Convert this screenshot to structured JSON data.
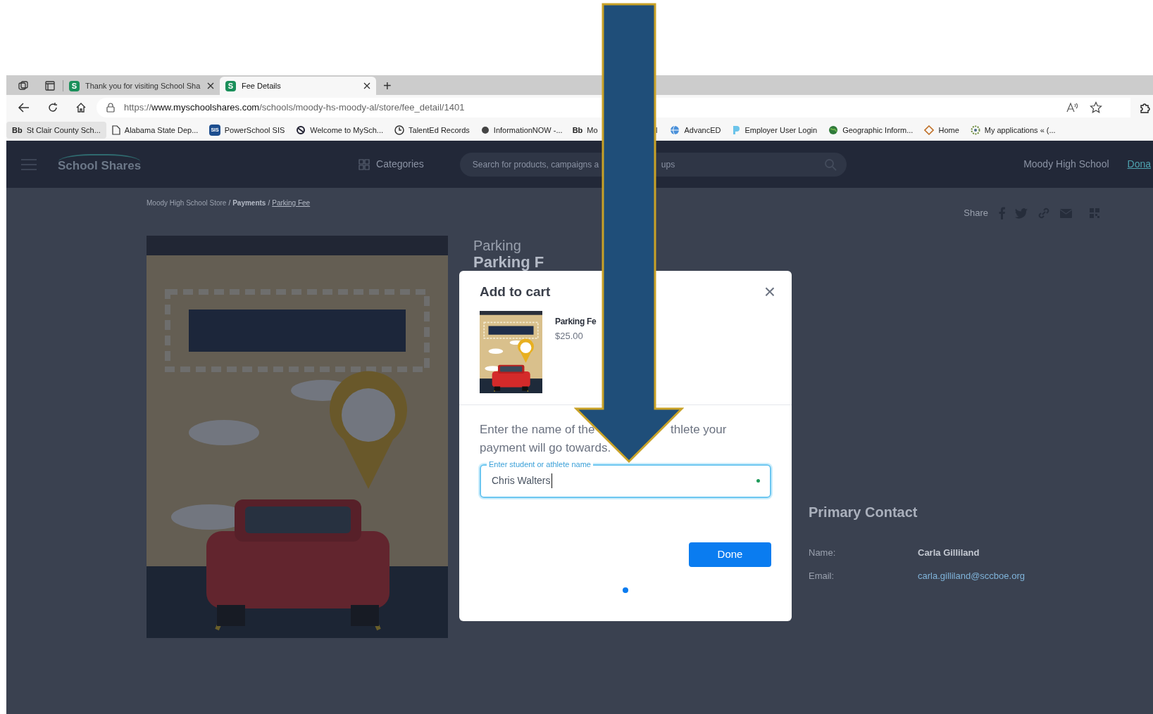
{
  "browser": {
    "tabs": [
      {
        "title": "Thank you for visiting School Sha",
        "favicon": "S",
        "selected": false
      },
      {
        "title": "Fee Details",
        "favicon": "S",
        "selected": true
      }
    ],
    "new_tab": "+",
    "url": {
      "scheme": "https://",
      "host": "www.myschoolshares.com",
      "path": "/schools/moody-hs-moody-al/store/fee_detail/1401"
    },
    "bookmarks": [
      {
        "kind": "bb",
        "icon_text": "Bb",
        "label": "St  Clair County Sch..."
      },
      {
        "kind": "page",
        "label": "Alabama State Dep..."
      },
      {
        "kind": "sis",
        "icon_text": "SIS",
        "label": "PowerSchool SIS"
      },
      {
        "kind": "logo",
        "label": "Welcome to MySch..."
      },
      {
        "kind": "clock",
        "label": "TalentEd Records"
      },
      {
        "kind": "dot",
        "label": "InformationNOW -..."
      },
      {
        "kind": "bb",
        "icon_text": "Bb",
        "label": "Mo"
      },
      {
        "kind": "fragment",
        "label": "l"
      },
      {
        "kind": "globe",
        "label": "AdvancED"
      },
      {
        "kind": "p",
        "label": "Employer User Login"
      },
      {
        "kind": "earth",
        "label": "Geographic Inform..."
      },
      {
        "kind": "diamond",
        "label": "Home"
      },
      {
        "kind": "gear",
        "label": "My applications « (..."
      }
    ]
  },
  "header": {
    "logo": "School Shares",
    "categories": "Categories",
    "search_placeholder": [
      "Search for products, campaigns a",
      "ups"
    ],
    "school": "Moody High School",
    "donate": "Dona"
  },
  "breadcrumb": [
    {
      "kind": "plain",
      "label": "Moody High School Store"
    },
    {
      "kind": "sep",
      "label": "/"
    },
    {
      "kind": "bold",
      "label": "Payments"
    },
    {
      "kind": "sep",
      "label": "/"
    },
    {
      "kind": "link",
      "label": "Parking Fee"
    }
  ],
  "share": {
    "label": "Share"
  },
  "product": {
    "category": "Parking",
    "title": "Parking F"
  },
  "contact": {
    "heading": "Primary Contact",
    "rows": [
      {
        "kind": "text",
        "label": "Name:",
        "value": "Carla Gilliland"
      },
      {
        "kind": "link",
        "label": "Email:",
        "value": "carla.gilliland@sccboe.org"
      }
    ]
  },
  "modal": {
    "title": "Add to cart",
    "close": "×",
    "item": {
      "name": "Parking Fe",
      "price": "$25.00"
    },
    "prompt": [
      "Enter the name of the",
      "thlete your",
      "payment will go towards."
    ],
    "field": {
      "label": "Enter student or athlete name",
      "value": "Chris Walters"
    },
    "button": "Done",
    "pager": [
      {
        "selected": true
      }
    ]
  }
}
